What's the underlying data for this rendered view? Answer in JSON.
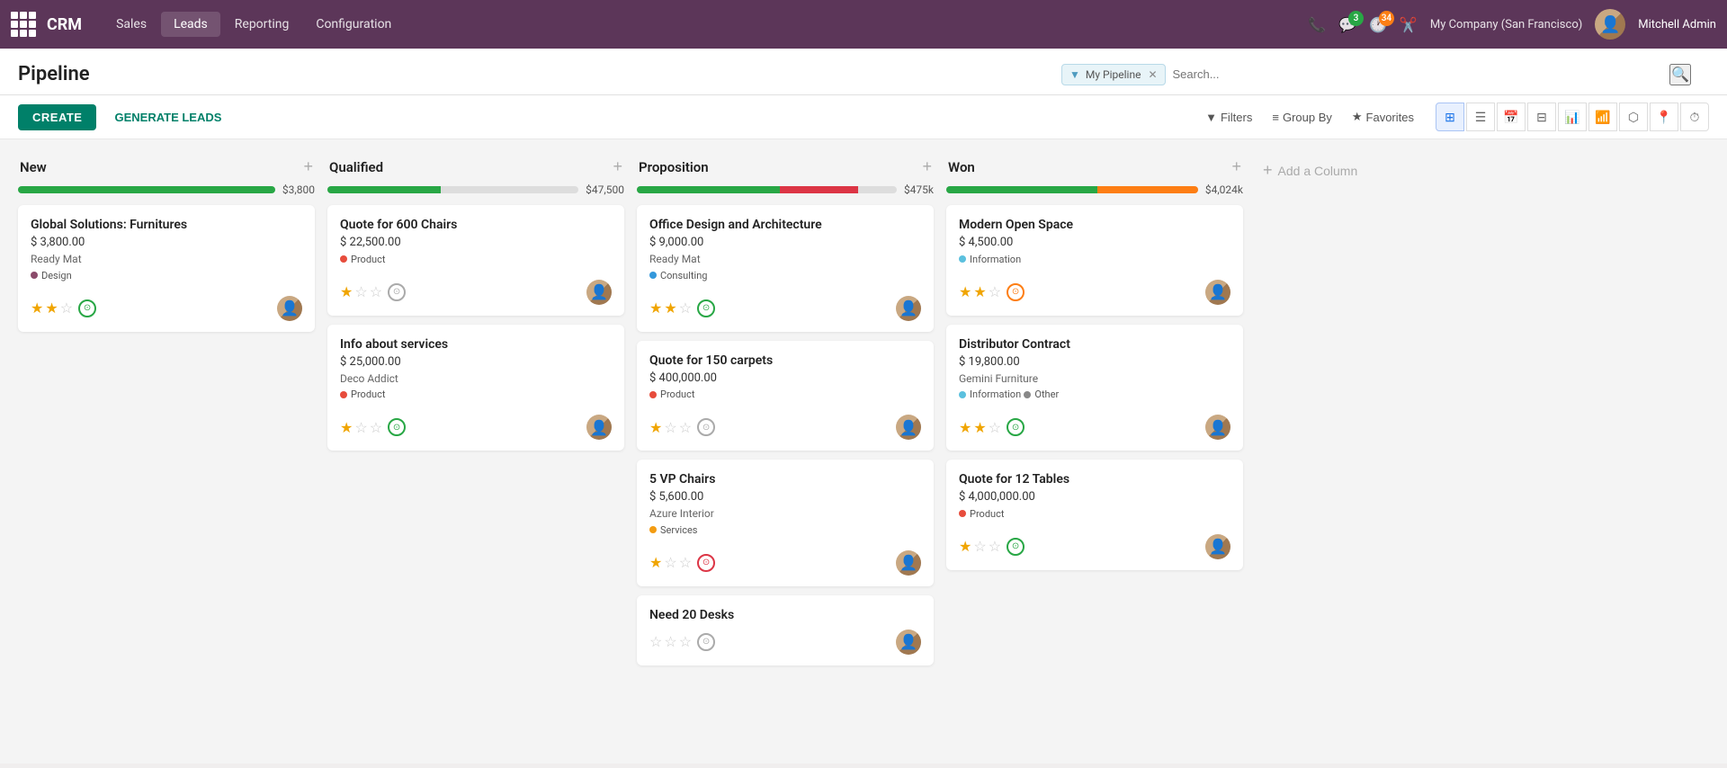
{
  "app": {
    "logo": "CRM",
    "nav_items": [
      "Sales",
      "Leads",
      "Reporting",
      "Configuration"
    ],
    "active_nav": "Leads",
    "company": "My Company (San Francisco)",
    "user": "Mitchell Admin",
    "notification_count": "3",
    "activity_count": "34"
  },
  "page": {
    "title": "Pipeline",
    "create_label": "CREATE",
    "generate_label": "GENERATE LEADS",
    "filter_tag": "My Pipeline",
    "search_placeholder": "Search...",
    "filters_label": "Filters",
    "groupby_label": "Group By",
    "favorites_label": "Favorites"
  },
  "columns": [
    {
      "id": "new",
      "title": "New",
      "amount": "$3,800",
      "progress_green": 100,
      "progress_red": 0,
      "progress_orange": 0,
      "cards": [
        {
          "title": "Global Solutions: Furnitures",
          "amount": "$ 3,800.00",
          "company": "Ready Mat",
          "tags": [
            {
              "label": "Design",
              "color": "#8B4B6B"
            }
          ],
          "stars": 2,
          "status": "green"
        }
      ]
    },
    {
      "id": "qualified",
      "title": "Qualified",
      "amount": "$47,500",
      "progress_green": 45,
      "progress_red": 0,
      "progress_orange": 0,
      "cards": [
        {
          "title": "Quote for 600 Chairs",
          "amount": "$ 22,500.00",
          "company": "",
          "tags": [
            {
              "label": "Product",
              "color": "#e74c3c"
            }
          ],
          "stars": 1,
          "status": "gray"
        },
        {
          "title": "Info about services",
          "amount": "$ 25,000.00",
          "company": "Deco Addict",
          "tags": [
            {
              "label": "Product",
              "color": "#e74c3c"
            }
          ],
          "stars": 1,
          "status": "green"
        }
      ]
    },
    {
      "id": "proposition",
      "title": "Proposition",
      "amount": "$475k",
      "progress_green": 55,
      "progress_red": 30,
      "progress_orange": 0,
      "cards": [
        {
          "title": "Office Design and Architecture",
          "amount": "$ 9,000.00",
          "company": "Ready Mat",
          "tags": [
            {
              "label": "Consulting",
              "color": "#3498db"
            }
          ],
          "stars": 2,
          "status": "green"
        },
        {
          "title": "Quote for 150 carpets",
          "amount": "$ 400,000.00",
          "company": "",
          "tags": [
            {
              "label": "Product",
              "color": "#e74c3c"
            }
          ],
          "stars": 1,
          "status": "gray"
        },
        {
          "title": "5 VP Chairs",
          "amount": "$ 5,600.00",
          "company": "Azure Interior",
          "tags": [
            {
              "label": "Services",
              "color": "#f39c12"
            }
          ],
          "stars": 1,
          "status": "red"
        },
        {
          "title": "Need 20 Desks",
          "amount": "",
          "company": "",
          "tags": [],
          "stars": 0,
          "status": "gray"
        }
      ]
    },
    {
      "id": "won",
      "title": "Won",
      "amount": "$4,024k",
      "progress_green": 60,
      "progress_red": 0,
      "progress_orange": 40,
      "cards": [
        {
          "title": "Modern Open Space",
          "amount": "$ 4,500.00",
          "company": "",
          "tags": [
            {
              "label": "Information",
              "color": "#5bc0de"
            }
          ],
          "stars": 2,
          "status": "orange"
        },
        {
          "title": "Distributor Contract",
          "amount": "$ 19,800.00",
          "company": "Gemini Furniture",
          "tags": [
            {
              "label": "Information",
              "color": "#5bc0de"
            },
            {
              "label": "Other",
              "color": "#888"
            }
          ],
          "stars": 2,
          "status": "green"
        },
        {
          "title": "Quote for 12 Tables",
          "amount": "$ 4,000,000.00",
          "company": "",
          "tags": [
            {
              "label": "Product",
              "color": "#e74c3c"
            }
          ],
          "stars": 1,
          "status": "green"
        }
      ]
    }
  ],
  "add_column_label": "Add a Column"
}
